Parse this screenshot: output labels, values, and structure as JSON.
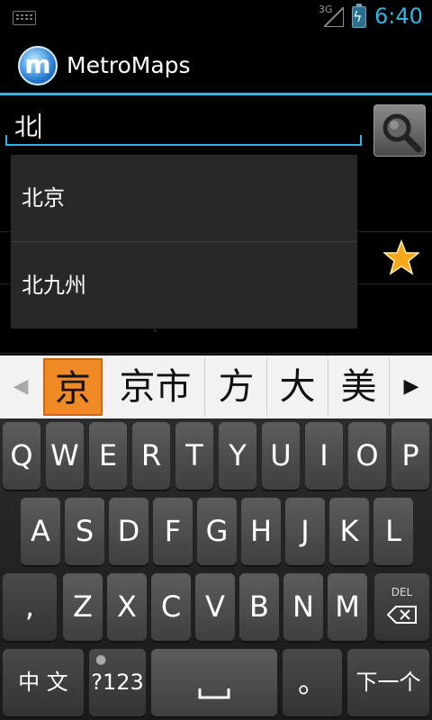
{
  "status_bar": {
    "network": "3G",
    "time": "6:40",
    "icons": [
      "keyboard-icon",
      "signal-icon",
      "battery-icon"
    ]
  },
  "action_bar": {
    "title": "MetroMaps",
    "logo_letter": "m"
  },
  "search": {
    "value": "北"
  },
  "dropdown": {
    "items": [
      "北京",
      "北九州"
    ]
  },
  "background_list": {
    "partial_text": "("
  },
  "candidates": {
    "items": [
      "京",
      "京市",
      "方",
      "大",
      "美"
    ],
    "selected_index": 0
  },
  "keyboard": {
    "row1": [
      "Q",
      "W",
      "E",
      "R",
      "T",
      "Y",
      "U",
      "I",
      "O",
      "P"
    ],
    "row2": [
      "A",
      "S",
      "D",
      "F",
      "G",
      "H",
      "J",
      "K",
      "L"
    ],
    "row3": [
      ",",
      "Z",
      "X",
      "C",
      "V",
      "B",
      "N",
      "M"
    ],
    "delete_label": "DEL",
    "lang_label": "中 文",
    "symbols_label": "?123",
    "period_label": "。",
    "next_label": "下一个"
  },
  "colors": {
    "accent": "#33b5e5",
    "candidate_highlight": "#f08a24",
    "background": "#000000"
  }
}
